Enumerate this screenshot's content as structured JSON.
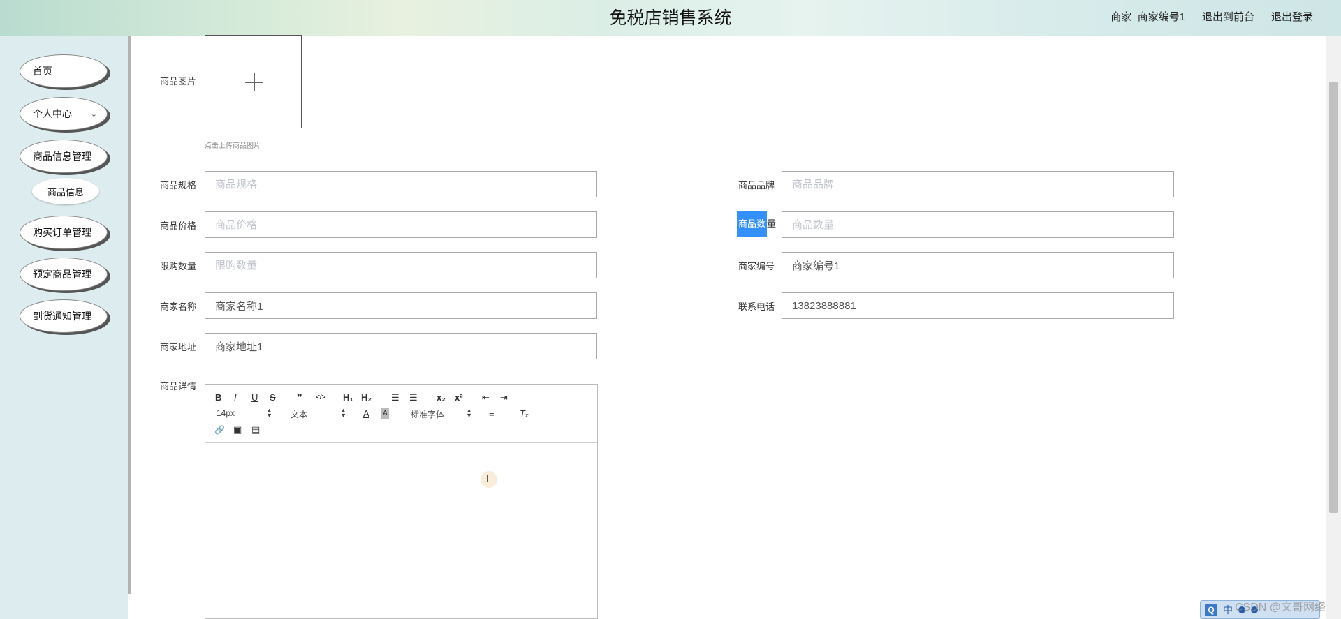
{
  "header": {
    "title": "免税店销售系统",
    "role": "商家",
    "username": "商家编号1",
    "goto_front": "退出到前台",
    "logout": "退出登录"
  },
  "sidebar": {
    "items": [
      {
        "label": "首页"
      },
      {
        "label": "个人中心"
      },
      {
        "label": "商品信息管理"
      },
      {
        "label": "购买订单管理"
      },
      {
        "label": "预定商品管理"
      },
      {
        "label": "到货通知管理"
      }
    ],
    "sub_items": [
      {
        "label": "商品信息"
      }
    ]
  },
  "form": {
    "image": {
      "label": "商品图片",
      "hint": "点击上传商品图片"
    },
    "spec": {
      "label": "商品规格",
      "placeholder": "商品规格",
      "value": ""
    },
    "brand": {
      "label": "商品品牌",
      "placeholder": "商品品牌",
      "value": ""
    },
    "price": {
      "label": "商品价格",
      "placeholder": "商品价格",
      "value": ""
    },
    "quantity": {
      "label_highlighted": "商品数",
      "label_rest": "量",
      "placeholder": "商品数量",
      "value": ""
    },
    "limit": {
      "label": "限购数量",
      "placeholder": "限购数量",
      "value": ""
    },
    "merchant_id": {
      "label": "商家编号",
      "placeholder": "商家编号",
      "value": "商家编号1"
    },
    "merchant_name": {
      "label": "商家名称",
      "placeholder": "商家名称",
      "value": "商家名称1"
    },
    "phone": {
      "label": "联系电话",
      "placeholder": "联系电话",
      "value": "13823888881"
    },
    "address": {
      "label": "商家地址",
      "placeholder": "商家地址",
      "value": "商家地址1"
    },
    "detail": {
      "label": "商品详情"
    }
  },
  "editor": {
    "font_size": "14px",
    "block_type": "文本",
    "font_family": "标准字体",
    "btn": {
      "bold": "B",
      "italic": "I",
      "underline": "U",
      "strike": "S",
      "quote": "❞",
      "code": "</>",
      "h1": "H₁",
      "h2": "H₂",
      "ordered_list": "☰",
      "bullet_list": "☰",
      "subscript": "x₂",
      "superscript": "x²",
      "outdent": "⇤",
      "indent": "⇥",
      "font_color": "A",
      "bg_color": "A",
      "align": "≡",
      "clean": "Tₓ",
      "link": "🔗",
      "image": "▣",
      "video": "▤"
    }
  },
  "ime": {
    "q": "Q",
    "zh": "中"
  },
  "watermark": "CSDN @文哥网络"
}
